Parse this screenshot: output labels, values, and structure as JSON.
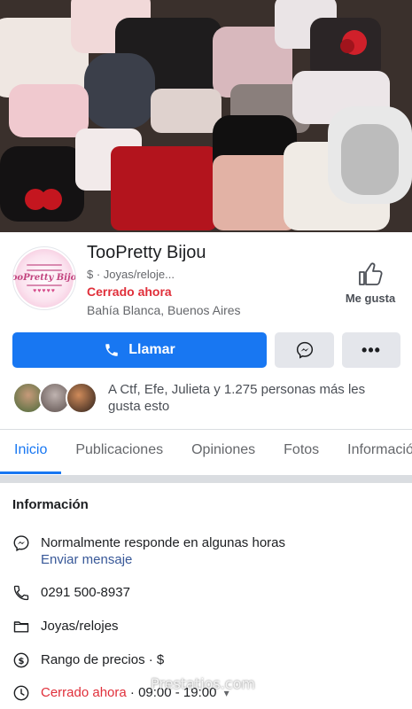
{
  "page": {
    "name": "TooPretty Bijou",
    "category": "$ · Joyas/reloje...",
    "status": "Cerrado ahora",
    "location": "Bahía Blanca, Buenos Aires",
    "like_label": "Me gusta",
    "logo_text": "TooPretty Bijou"
  },
  "actions": {
    "call_label": "Llamar",
    "messenger_icon": "messenger-icon",
    "more_label": "•••"
  },
  "social": {
    "likes_text": "A Ctf, Efe, Julieta y 1.275 personas más les gusta esto"
  },
  "tabs": [
    "Inicio",
    "Publicaciones",
    "Opiniones",
    "Fotos",
    "Informació"
  ],
  "info": {
    "title": "Información",
    "response": "Normalmente responde en algunas horas",
    "send_message": "Enviar mensaje",
    "phone": "0291 500-8937",
    "category_link": "Joyas/relojes",
    "price_range": "Rango de precios · $",
    "hours_status": "Cerrado ahora",
    "hours": " · 09:00 - 19:00"
  },
  "watermark": "Prestatios.com",
  "colors": {
    "accent": "#1877f2",
    "closed": "#e02f3a",
    "link": "#385898"
  }
}
